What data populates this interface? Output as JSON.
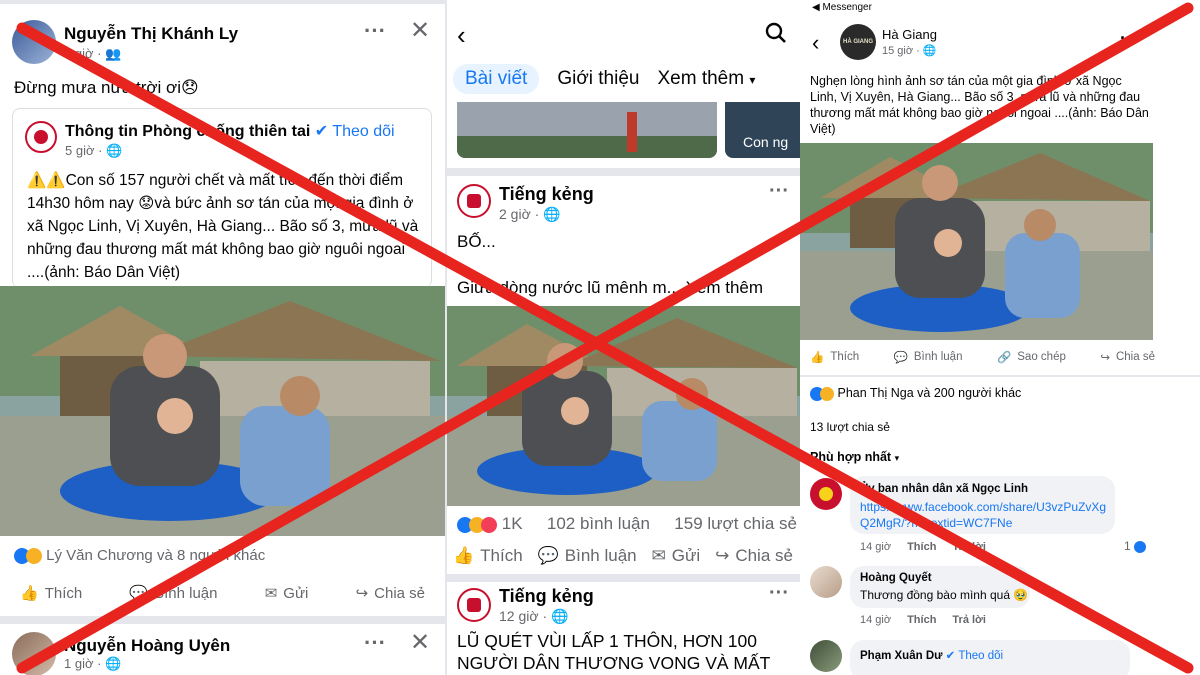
{
  "colors": {
    "fb_blue": "#1877f2",
    "cross_red": "#e8241f",
    "muted": "#65676b"
  },
  "panel1": {
    "author": "Nguyễn Thị Khánh Ly",
    "time": "6 giờ",
    "post_text": "Đừng mưa nữa trời ơi😞",
    "shared": {
      "page": "Thông tin Phòng chống thiên tai",
      "follow": "Theo dõi",
      "time": "5 giờ",
      "text": "⚠️⚠️Con số 157 người chết và mất tích đến thời điểm 14h30 hôm nay 😟và bức ảnh sơ tán của một gia đình ở xã Ngọc Linh, Vị Xuyên, Hà Giang... Bão số 3, mưa lũ và những đau thương mất mát không bao giờ nguôi ngoai ....(ảnh: Báo Dân Việt)"
    },
    "reactions": "Lý Văn Chương và 8 người khác",
    "actions": [
      "Thích",
      "Bình luận",
      "Gửi",
      "Chia sẻ"
    ],
    "next_author": "Nguyễn Hoàng Uyên",
    "next_time": "1 giờ"
  },
  "panel2": {
    "tabs": [
      "Bài viết",
      "Giới thiệu",
      "Xem thêm"
    ],
    "tile_label": "Con ng",
    "post1": {
      "author": "Tiếng kẻng",
      "time": "2 giờ",
      "line1": "BỐ...",
      "line2": "Giữa dòng nước lũ mênh m... Xem thêm",
      "reaction_count": "1K",
      "comments": "102 bình luận",
      "shares": "159 lượt chia sẻ"
    },
    "actions": [
      "Thích",
      "Bình luận",
      "Gửi",
      "Chia sẻ"
    ],
    "post2": {
      "author": "Tiếng kẻng",
      "time": "12 giờ",
      "headline": "LŨ QUÉT VÙI LẤP 1 THÔN, HƠN 100 NGƯỜI DÂN THƯƠNG VONG VÀ MẤT"
    }
  },
  "panel3": {
    "back_app": "◀ Messenger",
    "page": "Hà Giang",
    "avatar_text": "HÀ GIANG",
    "time": "15 giờ",
    "caption": "Nghẹn lòng hình ảnh sơ tán của một gia đình ở xã Ngọc Linh, Vị Xuyên, Hà Giang... Bão số 3, mưa lũ và những đau thương mất mát không bao giờ nguôi ngoai ....(ảnh: Báo Dân Việt)",
    "actions": [
      "Thích",
      "Bình luận",
      "Sao chép",
      "Chia sẻ"
    ],
    "reactions": "Phan Thị Nga và 200 người khác",
    "shares": "13 lượt chia sẻ",
    "sort": "Phù hợp nhất",
    "comments": [
      {
        "author": "Ủy ban nhân dân xã Ngọc Linh",
        "text": "https://www.facebook.com/share/U3vzPuZvXgQ2MgR/?mibextid=WC7FNe",
        "time": "14 giờ",
        "like": "Thích",
        "reply": "Trả lời",
        "count": "1"
      },
      {
        "author": "Hoàng Quyết",
        "text": "Thương đồng bào mình quá 🥹",
        "time": "14 giờ",
        "like": "Thích",
        "reply": "Trả lời"
      },
      {
        "author": "Phạm Xuân Dư",
        "follow": "Theo dõi"
      }
    ]
  }
}
